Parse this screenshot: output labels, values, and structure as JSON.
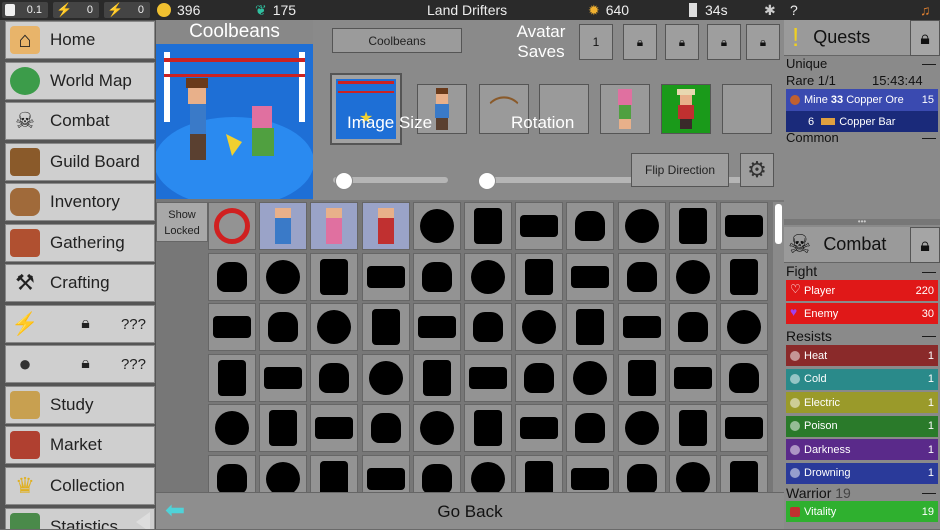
{
  "topbar": {
    "energy1": "0.1",
    "energy2": "0",
    "energy3": "0",
    "coins": "396",
    "gems": "175",
    "title": "Land Drifters",
    "suns": "640",
    "timer": "34s",
    "help": "?"
  },
  "sidebar": {
    "items": [
      {
        "label": "Home",
        "icon": "home-icon",
        "color": "#e8b46a"
      },
      {
        "label": "World Map",
        "icon": "globe-icon",
        "color": "#3c9c4a"
      },
      {
        "label": "Combat",
        "icon": "skull-icon",
        "color": "#dddddd"
      },
      {
        "label": "Guild Board",
        "icon": "board-icon",
        "color": "#8a5a2a"
      },
      {
        "label": "Inventory",
        "icon": "backpack-icon",
        "color": "#a06a3a"
      },
      {
        "label": "Gathering",
        "icon": "pickaxe-icon",
        "color": "#b05030"
      },
      {
        "label": "Crafting",
        "icon": "hammer-icon",
        "color": "#666"
      },
      {
        "label": "Study",
        "icon": "book-icon",
        "color": "#c8a050"
      },
      {
        "label": "Market",
        "icon": "market-icon",
        "color": "#b04030"
      },
      {
        "label": "Collection",
        "icon": "trophy-icon",
        "color": "#e0b020"
      },
      {
        "label": "Statistics",
        "icon": "chart-icon",
        "color": "#4a8a4a"
      }
    ],
    "locked": [
      "???",
      "???"
    ]
  },
  "avatar": {
    "name": "Coolbeans",
    "name_field": "Coolbeans",
    "saves_label": "Avatar Saves",
    "save_slot": "1",
    "image_size_label": "Image Size",
    "rotation_label": "Rotation",
    "flip_label": "Flip Direction",
    "show_locked": "Show Locked",
    "go_back": "Go Back",
    "image_size": 0.03,
    "rotation": 0.0
  },
  "quests": {
    "title": "Quests",
    "unique": "Unique",
    "rare": "Rare 1/1",
    "rare_time": "15:43:44",
    "mine_label": "Mine",
    "mine_count": "33",
    "mine_item": "Copper Ore",
    "mine_value": "15",
    "bar_count": "6",
    "bar_item": "Copper Bar",
    "common": "Common"
  },
  "combat": {
    "title": "Combat",
    "fight": "Fight",
    "player": "Player",
    "player_val": "220",
    "enemy": "Enemy",
    "enemy_val": "30",
    "resists": "Resists",
    "resist_list": [
      {
        "label": "Heat",
        "value": "1",
        "color": "#8a2a2a"
      },
      {
        "label": "Cold",
        "value": "1",
        "color": "#2a8a8a"
      },
      {
        "label": "Electric",
        "value": "1",
        "color": "#9a9a2a"
      },
      {
        "label": "Poison",
        "value": "1",
        "color": "#2a7a2a"
      },
      {
        "label": "Darkness",
        "value": "1",
        "color": "#5a2a8a"
      },
      {
        "label": "Drowning",
        "value": "1",
        "color": "#2a3a9a"
      }
    ],
    "warrior": "Warrior",
    "warrior_lvl": "19",
    "vitality": "Vitality",
    "vitality_val": "19"
  }
}
